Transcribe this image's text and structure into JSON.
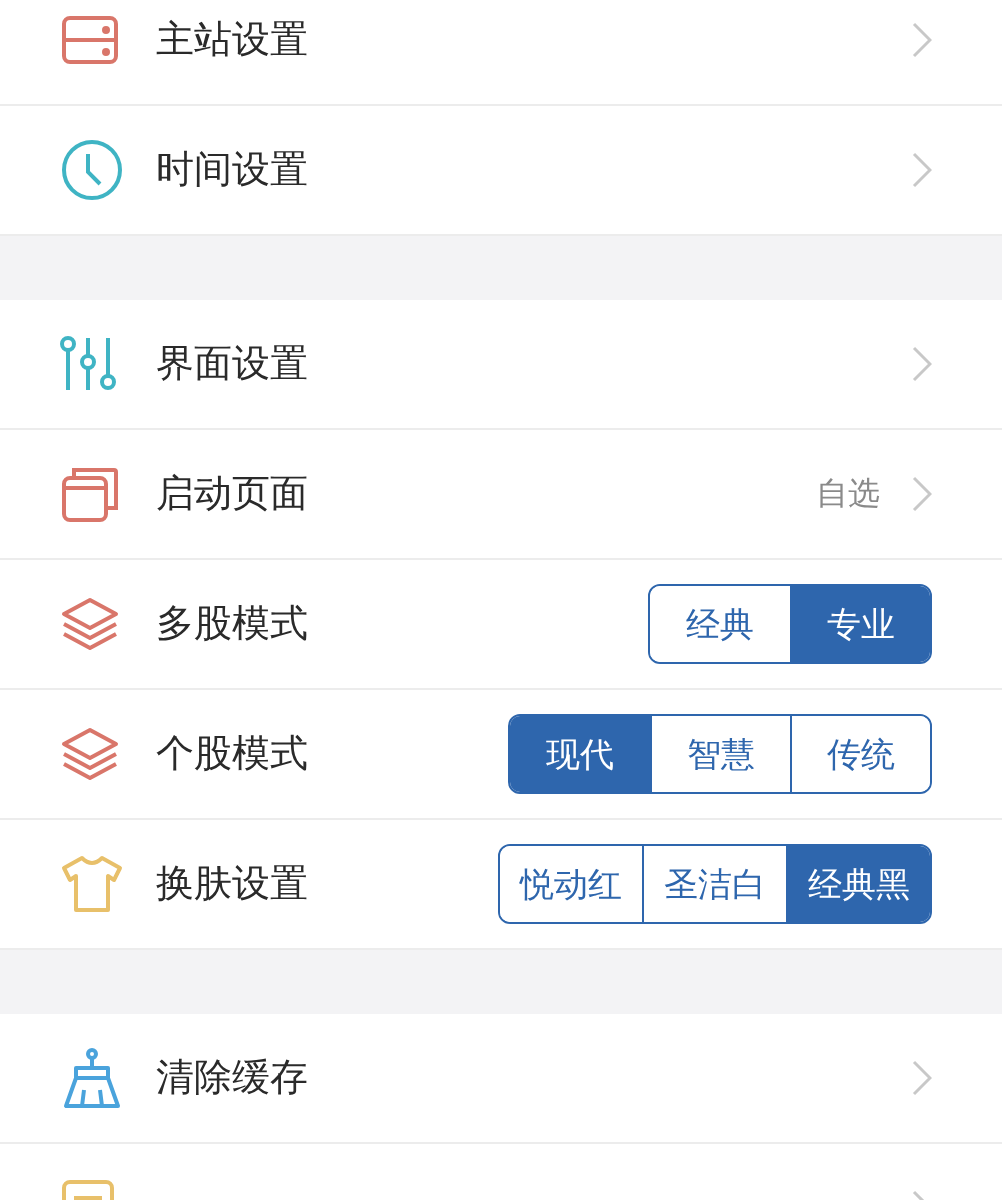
{
  "sections": [
    {
      "items": [
        {
          "label": "主站设置",
          "kind": "chevron"
        },
        {
          "label": "时间设置",
          "kind": "chevron"
        }
      ]
    },
    {
      "items": [
        {
          "label": "界面设置",
          "kind": "chevron"
        },
        {
          "label": "启动页面",
          "kind": "value",
          "value": "自选"
        },
        {
          "label": "多股模式",
          "kind": "segmented",
          "options": [
            {
              "label": "经典",
              "selected": false
            },
            {
              "label": "专业",
              "selected": true
            }
          ]
        },
        {
          "label": "个股模式",
          "kind": "segmented",
          "options": [
            {
              "label": "现代",
              "selected": true
            },
            {
              "label": "智慧",
              "selected": false
            },
            {
              "label": "传统",
              "selected": false
            }
          ]
        },
        {
          "label": "换肤设置",
          "kind": "segmented",
          "options": [
            {
              "label": "悦动红",
              "selected": false
            },
            {
              "label": "圣洁白",
              "selected": false
            },
            {
              "label": "经典黑",
              "selected": true
            }
          ]
        }
      ]
    },
    {
      "items": [
        {
          "label": "清除缓存",
          "kind": "chevron"
        },
        {
          "kind": "chevron"
        }
      ]
    }
  ]
}
